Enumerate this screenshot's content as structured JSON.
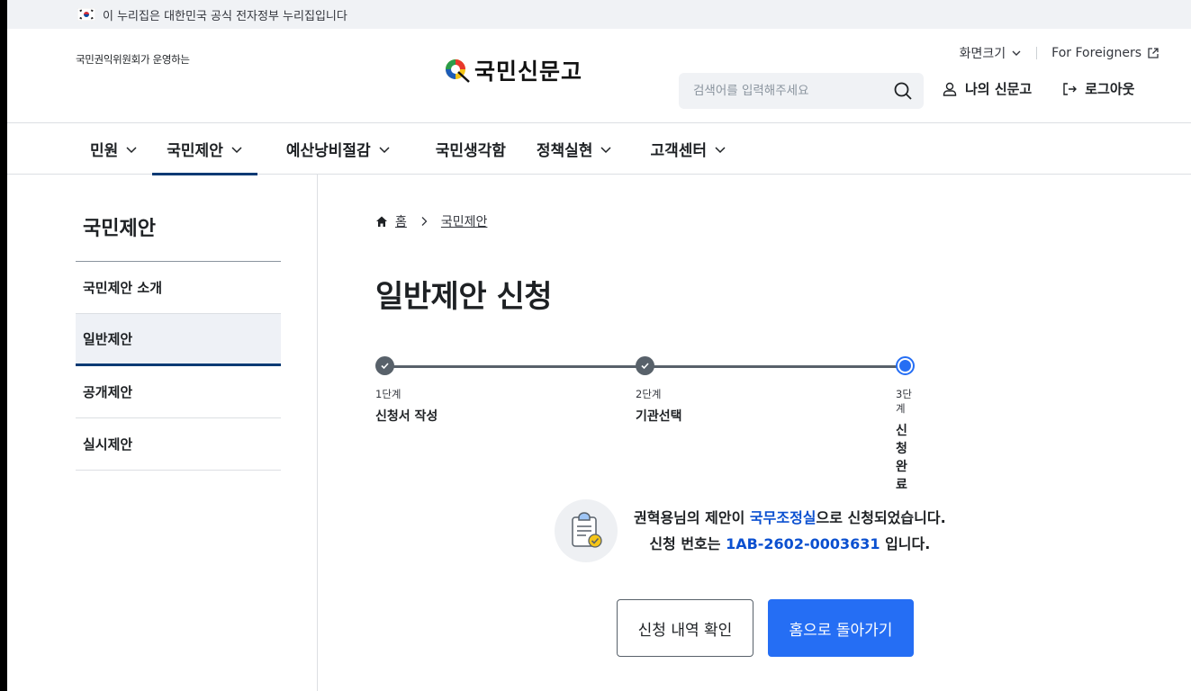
{
  "gov_banner": {
    "text": "이 누리집은 대한민국 공식 전자정부 누리집입니다"
  },
  "logo": {
    "sub": "국민권익위원회가 운영하는",
    "name": "국민신문고"
  },
  "util": {
    "font_size": "화면크기",
    "foreigners": "For Foreigners"
  },
  "search": {
    "placeholder": "검색어를 입력해주세요"
  },
  "user_links": {
    "my": "나의 신문고",
    "logout": "로그아웃"
  },
  "gnb": [
    {
      "label": "민원"
    },
    {
      "label": "국민제안"
    },
    {
      "label": "예산낭비절감"
    },
    {
      "label": "국민생각함"
    },
    {
      "label": "정책실현"
    },
    {
      "label": "고객센터"
    }
  ],
  "lnb": {
    "title": "국민제안",
    "items": [
      {
        "label": "국민제안 소개"
      },
      {
        "label": "일반제안"
      },
      {
        "label": "공개제안"
      },
      {
        "label": "실시제안"
      }
    ]
  },
  "breadcrumb": {
    "home": "홈",
    "current": "국민제안"
  },
  "page_title": "일반제안 신청",
  "steps": [
    {
      "no": "1단계",
      "name": "신청서 작성",
      "state": "done"
    },
    {
      "no": "2단계",
      "name": "기관선택",
      "state": "done"
    },
    {
      "no": "3단계",
      "name": "신청완료",
      "state": "current"
    }
  ],
  "result": {
    "line1_pre": "권혁용님의 제안이 ",
    "agency": "국무조정실",
    "line1_post": "으로 신청되었습니다.",
    "line2_pre": "신청 번호는 ",
    "number": "1AB-2602-0003631",
    "line2_post": " 입니다."
  },
  "buttons": {
    "check": "신청 내역 확인",
    "home": "홈으로 돌아가기"
  },
  "colors": {
    "primary": "#256ef4",
    "navy": "#063a74",
    "highlight": "#0b50d0",
    "gray": "#58616a"
  }
}
